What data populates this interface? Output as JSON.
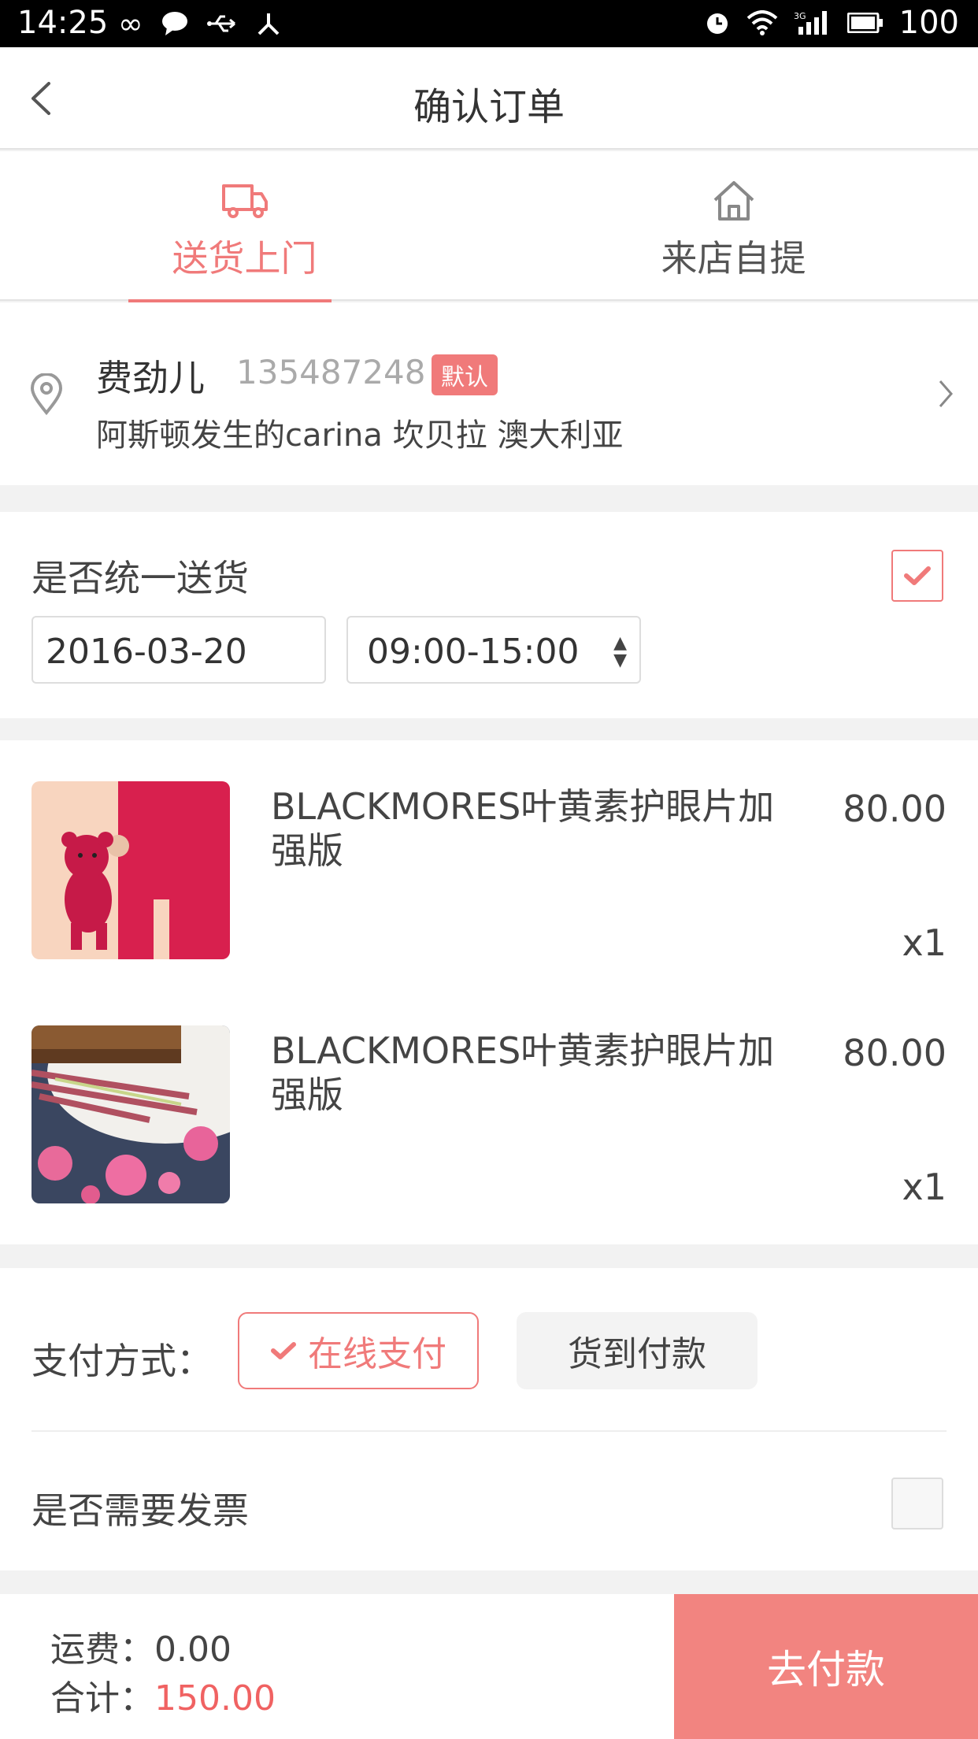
{
  "status_bar": {
    "time": "14:25",
    "battery": "100",
    "left_icons": [
      "infinity-icon",
      "chat-icon",
      "usb-icon",
      "share-icon"
    ],
    "right_icons": [
      "alarm-icon",
      "wifi-icon",
      "signal-3g-icon",
      "battery-icon"
    ],
    "network": "3G"
  },
  "header": {
    "title": "确认订单"
  },
  "tabs": [
    {
      "label": "送货上门",
      "icon": "truck-icon",
      "active": true
    },
    {
      "label": "来店自提",
      "icon": "home-icon",
      "active": false
    }
  ],
  "address": {
    "name": "费劲儿",
    "phone": "135487248",
    "badge": "默认",
    "detail": "阿斯顿发生的carina 坎贝拉 澳大利亚"
  },
  "delivery": {
    "label": "是否统一送货",
    "checked": true,
    "date": "2016-03-20",
    "time_slot": "09:00-15:00"
  },
  "products": [
    {
      "name": "BLACKMORES叶黄素护眼片加强版",
      "price": "80.00",
      "qty": "x1",
      "image": "red-teddy-bear-photo"
    },
    {
      "name": "BLACKMORES叶黄素护眼片加强版",
      "price": "80.00",
      "qty": "x1",
      "image": "cake-and-flowers-photo"
    }
  ],
  "payment": {
    "label": "支付方式：",
    "online": "在线支付",
    "cod": "货到付款",
    "selected": "online"
  },
  "invoice": {
    "label": "是否需要发票",
    "checked": false
  },
  "footer": {
    "shipping_label": "运费：",
    "shipping": "0.00",
    "total_label": "合计：",
    "total": "150.00",
    "pay_button": "去付款"
  },
  "colors": {
    "accent": "#f07a7a",
    "pay_button": "#f28480",
    "total_price": "#f06262"
  }
}
